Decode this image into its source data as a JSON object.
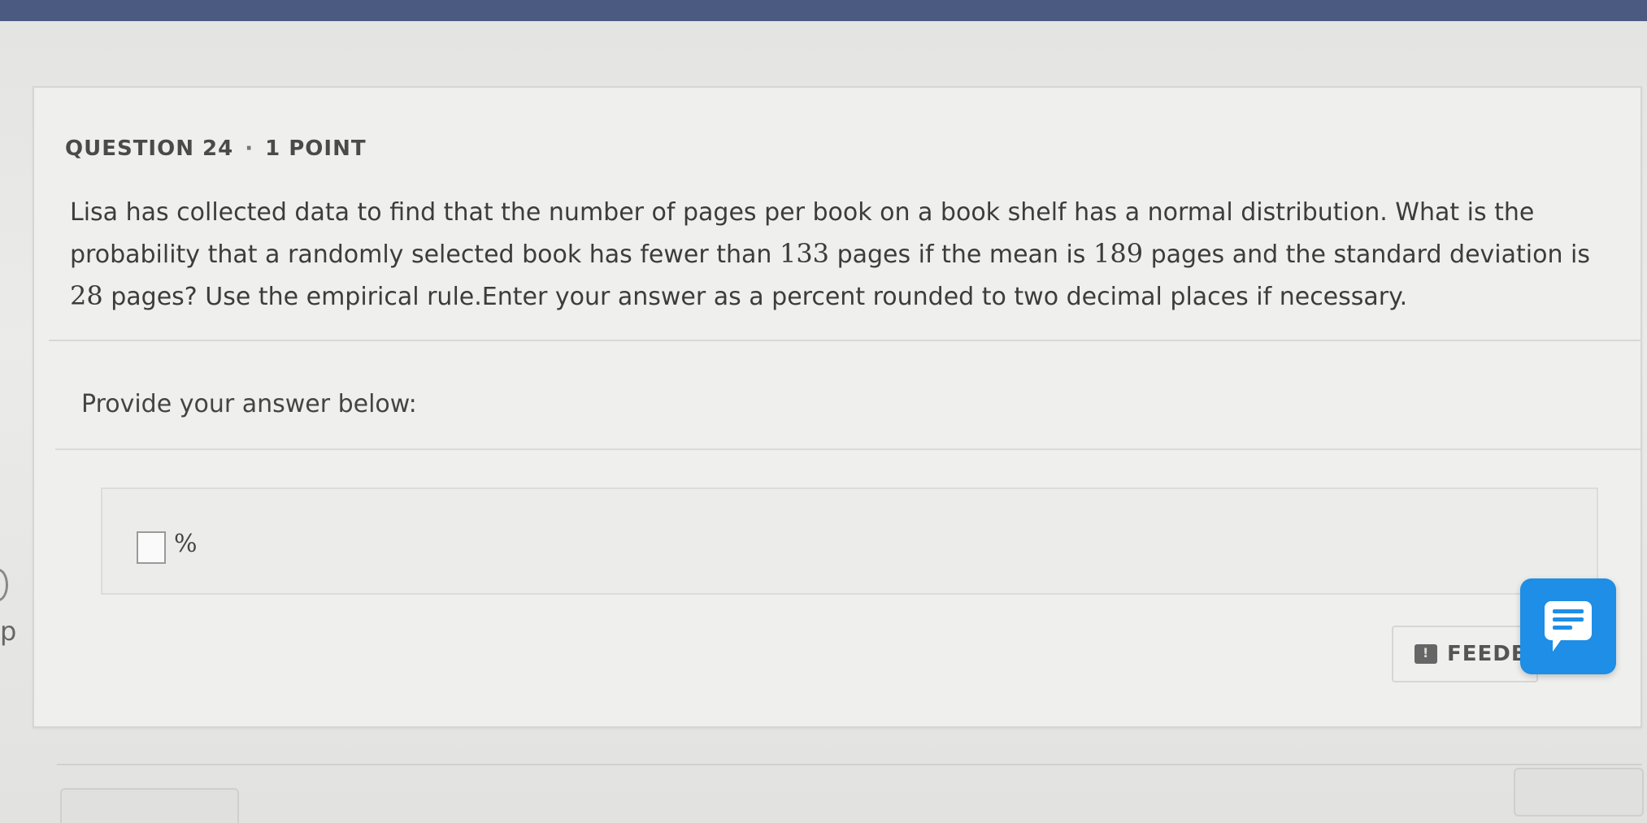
{
  "question": {
    "number_label": "QUESTION 24",
    "separator": "·",
    "points_label": "1 POINT",
    "text_part1": "Lisa has collected data to find that the number of pages per book on a book shelf has a normal distribution. What is the probability that a randomly selected book has fewer than ",
    "value1": "133",
    "text_part2": " pages if the mean is ",
    "value2": "189",
    "text_part3": " pages and the standard deviation is ",
    "value3": "28",
    "text_part4": " pages? Use the empirical rule.Enter your answer as a percent rounded to two decimal places if necessary."
  },
  "answer": {
    "prompt": "Provide your answer below:",
    "input_value": "",
    "unit": "%"
  },
  "left_edge": {
    "fragment": "p"
  },
  "feedback": {
    "label": "FEEDB"
  },
  "icons": {
    "feedback": "feedback-icon",
    "chat": "chat-icon"
  },
  "colors": {
    "top_bar": "#4a5a80",
    "chat_button": "#1e8ee6"
  }
}
